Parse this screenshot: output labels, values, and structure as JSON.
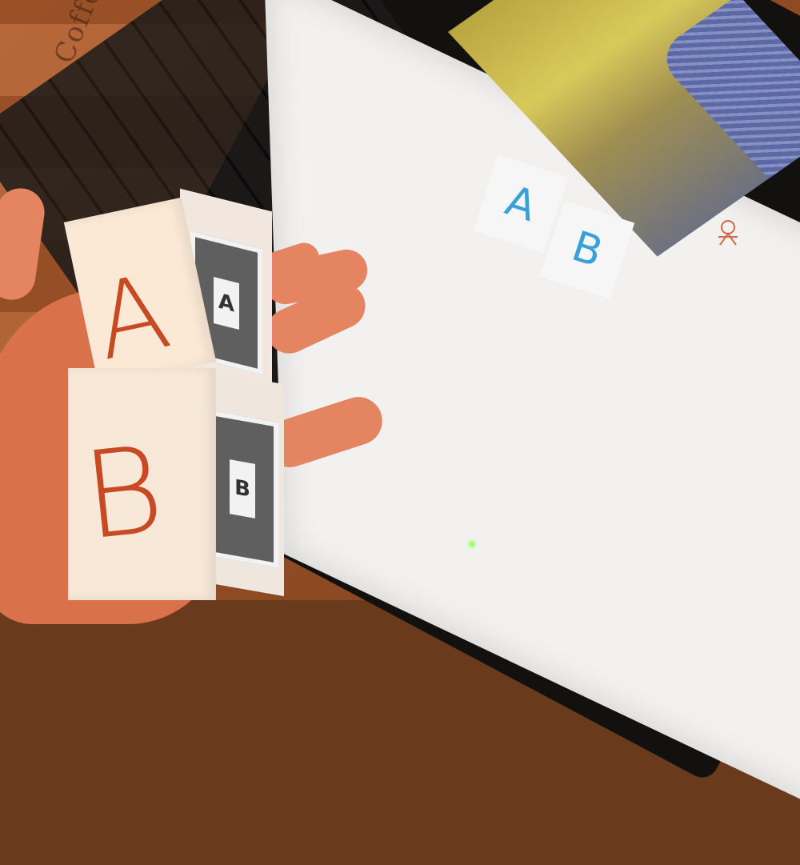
{
  "scene": {
    "tablecloth_text": "Coffee",
    "colors": {
      "tablecloth": "#9b5126",
      "laptop": "#121110",
      "screen": "#f2f1f0",
      "cube_letter": "#c74a24",
      "screen_letter": "#3aa0d8",
      "marker": "#5f5f5f",
      "skin": "#e58461",
      "power_led": "#9fff7a"
    }
  },
  "physical_cubes": {
    "top": {
      "letter": "A",
      "side_marker_symbol": "A"
    },
    "bottom": {
      "letter": "B",
      "side_marker_symbol": "B"
    }
  },
  "screen": {
    "webcam_cards": [
      {
        "letter": "A"
      },
      {
        "letter": "B"
      }
    ],
    "doodle_icon": "hand-drawn-character-icon"
  }
}
